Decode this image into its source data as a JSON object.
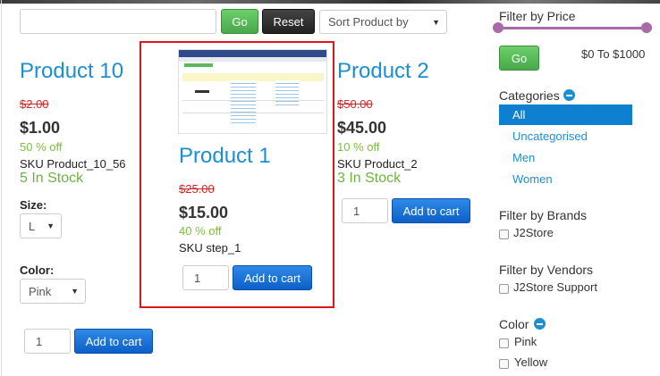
{
  "toolbar": {
    "search_placeholder": "",
    "go_label": "Go",
    "reset_label": "Reset",
    "sort_label": "Sort Product by"
  },
  "products": [
    {
      "title": "Product 10",
      "old_price": "$2.00",
      "price": "$1.00",
      "discount": "50 % off",
      "sku": "SKU Product_10_56",
      "stock": "5 In Stock",
      "size_label": "Size:",
      "size_value": "L",
      "color_label": "Color:",
      "color_value": "Pink",
      "qty": "1",
      "add_label": "Add to cart"
    },
    {
      "title": "Product 1",
      "old_price": "$25.00",
      "price": "$15.00",
      "discount": "40 % off",
      "sku": "SKU step_1",
      "qty": "1",
      "add_label": "Add to cart"
    },
    {
      "title": "Product 2",
      "old_price": "$50.00",
      "price": "$45.00",
      "discount": "10 % off",
      "sku": "SKU Product_2",
      "stock": "3 In Stock",
      "qty": "1",
      "add_label": "Add to cart"
    }
  ],
  "sidebar": {
    "price_filter": {
      "heading": "Filter by Price",
      "go_label": "Go",
      "range_text": "$0 To $1000",
      "min_fraction": 0,
      "max_fraction": 1
    },
    "categories": {
      "heading": "Categories",
      "items": [
        "All",
        "Uncategorised",
        "Men",
        "Women"
      ],
      "active": "All"
    },
    "brands": {
      "heading": "Filter by Brands",
      "items": [
        "J2Store"
      ]
    },
    "vendors": {
      "heading": "Filter by Vendors",
      "items": [
        "J2Store Support"
      ]
    },
    "color": {
      "heading": "Color",
      "items": [
        "Pink",
        "Yellow"
      ]
    }
  },
  "colors": {
    "accent": "#1b8fd2",
    "go_green": "#49a84a",
    "cart_blue": "#0d5fc9",
    "sale_red": "#e02020",
    "discount_green": "#7cc03a",
    "slider": "#a86aa8",
    "highlight_red": "#e0161b"
  }
}
